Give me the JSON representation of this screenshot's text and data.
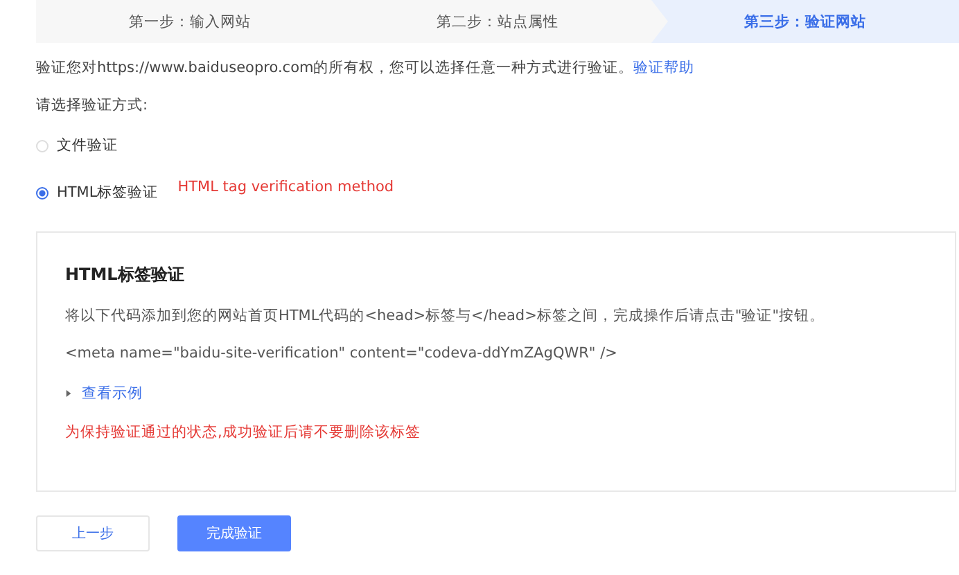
{
  "steps": [
    {
      "label": "第一步：输入网站",
      "selected": false
    },
    {
      "label": "第二步：站点属性",
      "selected": false
    },
    {
      "label": "第三步：验证网站",
      "selected": true
    }
  ],
  "intro": {
    "text": "验证您对https://www.baiduseopro.com的所有权，您可以选择任意一种方式进行验证。",
    "link": "验证帮助"
  },
  "method_prompt": "请选择验证方式:",
  "methods": [
    {
      "label": "文件验证",
      "selected": false
    },
    {
      "label": "HTML标签验证",
      "selected": true,
      "annotation": "HTML tag verification method"
    }
  ],
  "panel": {
    "title": "HTML标签验证",
    "instruction": "将以下代码添加到您的网站首页HTML代码的<head>标签与</head>标签之间，完成操作后请点击\"验证\"按钮。",
    "code": "<meta name=\"baidu-site-verification\" content=\"codeva-ddYmZAgQWR\" />",
    "example": {
      "label": "查看示例",
      "expanded": false
    },
    "warning": "为保持验证通过的状态,成功验证后请不要删除该标签"
  },
  "buttons": [
    {
      "label": "上一步",
      "kind": "secondary"
    },
    {
      "label": "完成验证",
      "kind": "primary"
    }
  ]
}
